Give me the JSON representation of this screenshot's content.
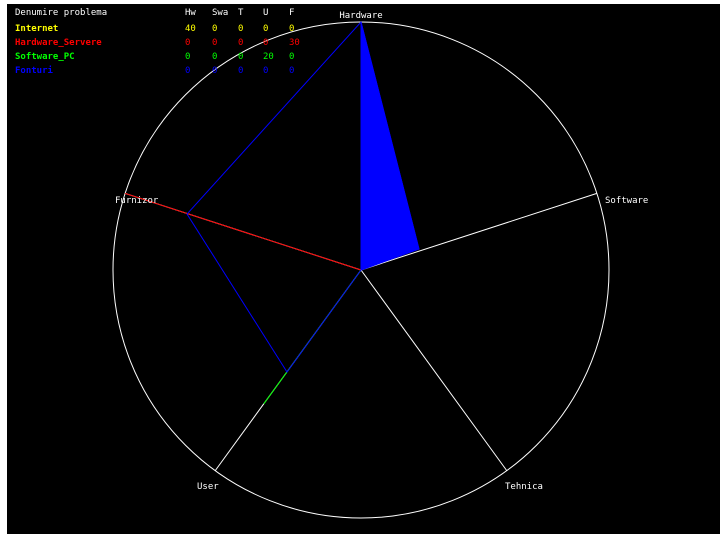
{
  "chart_data": {
    "type": "radar",
    "legend_header": {
      "title": "Denumire problema",
      "columns": [
        "Hw",
        "Swa",
        "T",
        "U",
        "F"
      ]
    },
    "axes": [
      "Hardware",
      "Software",
      "Tehnica",
      "User",
      "Furnizor"
    ],
    "rmax": 30,
    "series": [
      {
        "name": "Internet",
        "color": "#ffff00",
        "values": [
          40,
          0,
          0,
          0,
          0
        ]
      },
      {
        "name": "Hardware_Servere",
        "color": "#ff0000",
        "values": [
          0,
          0,
          0,
          0,
          30
        ]
      },
      {
        "name": "Software_PC",
        "color": "#00ff00",
        "values": [
          0,
          0,
          0,
          20,
          0
        ]
      },
      {
        "name": "Fonturi",
        "color": "#0000ff",
        "values": [
          0,
          0,
          0,
          0,
          0
        ]
      }
    ],
    "colors": {
      "background": "#000000",
      "grid": "#ffffff"
    }
  }
}
